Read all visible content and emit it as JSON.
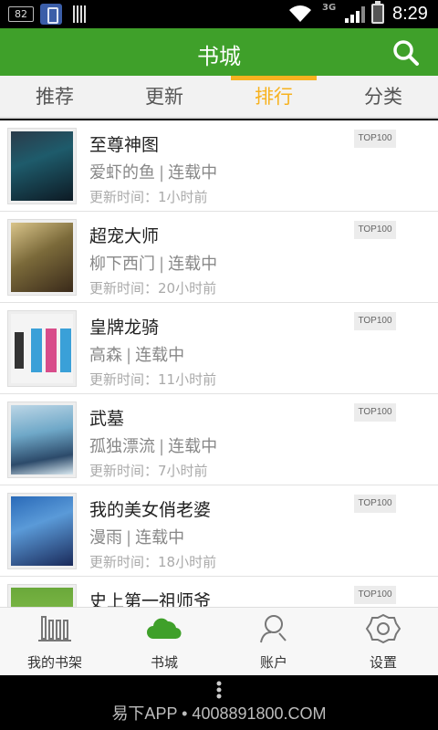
{
  "status_bar": {
    "battery_pct": "82",
    "network": "3G",
    "time": "8:29"
  },
  "header": {
    "title": "书城",
    "search_icon": "search-icon"
  },
  "tabs": [
    {
      "label": "推荐",
      "active": false
    },
    {
      "label": "更新",
      "active": false
    },
    {
      "label": "排行",
      "active": true
    },
    {
      "label": "分类",
      "active": false
    }
  ],
  "books": [
    {
      "title": "至尊神图",
      "author": "爱虾的鱼",
      "status": "连载中",
      "update": "更新时间：1小时前",
      "badge": "TOP100"
    },
    {
      "title": "超宠大师",
      "author": "柳下西门",
      "status": "连载中",
      "update": "更新时间：20小时前",
      "badge": "TOP100"
    },
    {
      "title": "皇牌龙骑",
      "author": "高森",
      "status": "连载中",
      "update": "更新时间：11小时前",
      "badge": "TOP100"
    },
    {
      "title": "武墓",
      "author": "孤独漂流",
      "status": "连载中",
      "update": "更新时间：7小时前",
      "badge": "TOP100"
    },
    {
      "title": "我的美女俏老婆",
      "author": "漫雨",
      "status": "连载中",
      "update": "更新时间：18小时前",
      "badge": "TOP100"
    },
    {
      "title": "史上第一祖师爷",
      "author": "",
      "status": "",
      "update": "",
      "badge": "TOP100"
    }
  ],
  "bottom_nav": [
    {
      "label": "我的书架",
      "icon": "bookshelf-icon"
    },
    {
      "label": "书城",
      "icon": "cloud-icon"
    },
    {
      "label": "账户",
      "icon": "account-icon"
    },
    {
      "label": "设置",
      "icon": "settings-icon"
    }
  ],
  "watermark": "易下APP • 4008891800.COM",
  "colors": {
    "brand_green": "#3fa02a",
    "active_tab": "#f7b21f"
  }
}
